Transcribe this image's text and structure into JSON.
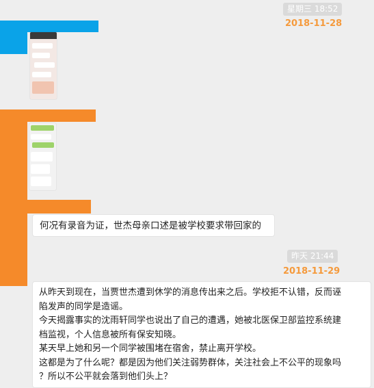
{
  "chat": {
    "timestamp_1": "星期三 18:52",
    "date_1": "2018-11-28",
    "message_1": "何况有录音为证，世杰母亲口述是被学校要求带回家的",
    "timestamp_2": "昨天 21:44",
    "date_2": "2018-11-29",
    "message_2": {
      "lines": [
        "从昨天到现在，当贾世杰遭到休学的消息传出来之后。学校拒不认错，反而诬",
        "陷发声的同学是造谣。",
        "今天揭露事实的沈雨轩同学也说出了自己的遭遇，她被北医保卫部监控系统建",
        "档监视，个人信息被所有保安知晓。",
        "某天早上她和另一个同学被围堵在宿舍，禁止离开学校。",
        "这都是为了什么呢？都是因为他们关注弱势群体，关注社会上不公平的现象吗",
        "？所以不公平就会落到他们头上？"
      ]
    }
  },
  "colors": {
    "background": "#eeeeee",
    "redaction_blue": "#0aa3e8",
    "redaction_orange": "#f58a2a",
    "date_orange": "#f59a3c",
    "timestamp_pill": "#dadada",
    "bubble": "#ffffff"
  }
}
